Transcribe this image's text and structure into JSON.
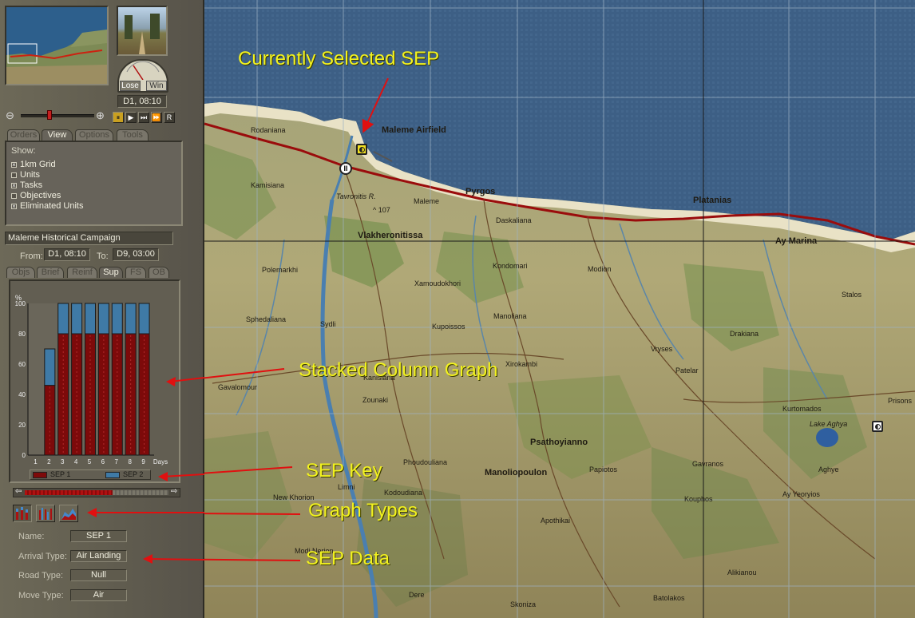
{
  "overview": {
    "time": "D1, 08:10",
    "lose_label": "Lose",
    "win_label": "Win"
  },
  "playback": {
    "buttons": [
      "⏸",
      "▶",
      "⏭",
      "⏩",
      "R"
    ]
  },
  "main_tabs": [
    "Orders",
    "View",
    "Options",
    "Tools"
  ],
  "view": {
    "show_label": "Show:",
    "options": [
      {
        "label": "1km Grid",
        "checked": true
      },
      {
        "label": "Units",
        "checked": false
      },
      {
        "label": "Tasks",
        "checked": true
      },
      {
        "label": "Objectives",
        "checked": false
      },
      {
        "label": "Eliminated Units",
        "checked": true
      }
    ]
  },
  "campaign": {
    "name": "Maleme Historical Campaign",
    "from_label": "From:",
    "from": "D1, 08:10",
    "to_label": "To:",
    "to": "D9, 03:00"
  },
  "sub_tabs": [
    "Objs",
    "Brief",
    "Reinf",
    "Sup",
    "FS",
    "OB"
  ],
  "chart_data": {
    "type": "bar",
    "stacked": true,
    "categories": [
      "1",
      "2",
      "3",
      "4",
      "5",
      "6",
      "7",
      "8",
      "9"
    ],
    "series": [
      {
        "name": "SEP 1",
        "values": [
          0,
          46,
          80,
          80,
          80,
          80,
          80,
          80,
          80
        ]
      },
      {
        "name": "SEP 2",
        "values": [
          0,
          24,
          20,
          20,
          20,
          20,
          20,
          20,
          20
        ]
      }
    ],
    "ylabel": "%",
    "xlabel": "Days",
    "yticks": [
      "0",
      "20",
      "40",
      "60",
      "80",
      "100"
    ],
    "ylim": [
      0,
      100
    ],
    "colors": {
      "sep1": "#7d0a0a",
      "sep2": "#3f7aa6"
    }
  },
  "sep_data": {
    "name_label": "Name:",
    "name": "SEP 1",
    "arrival_label": "Arrival Type:",
    "arrival": "Air Landing",
    "road_label": "Road Type:",
    "road": "Null",
    "move_label": "Move Type:",
    "move": "Air"
  },
  "annotations": {
    "selected": "Currently Selected SEP",
    "graph": "Stacked Column Graph",
    "key": "SEP Key",
    "types": "Graph Types",
    "data": "SEP Data"
  },
  "map": {
    "places": [
      {
        "name": "Rodaniana",
        "big": false
      },
      {
        "name": "Maleme Airfield",
        "big": true
      },
      {
        "name": "Kamisiana",
        "big": false
      },
      {
        "name": "Tavronitis R.",
        "big": false
      },
      {
        "name": "Maleme",
        "big": false
      },
      {
        "name": "Pyrgos",
        "big": true
      },
      {
        "name": "^ 107",
        "big": false
      },
      {
        "name": "Daskaliana",
        "big": false
      },
      {
        "name": "Vlakheronitissa",
        "big": true
      },
      {
        "name": "Platanias",
        "big": true
      },
      {
        "name": "Ay Marina",
        "big": true
      },
      {
        "name": "Polemarkhi",
        "big": false
      },
      {
        "name": "Kondomari",
        "big": false
      },
      {
        "name": "Modion",
        "big": false
      },
      {
        "name": "Xamoudokhori",
        "big": false
      },
      {
        "name": "Stalos",
        "big": false
      },
      {
        "name": "Sphedaliana",
        "big": false
      },
      {
        "name": "Sydli",
        "big": false
      },
      {
        "name": "Manoliana",
        "big": false
      },
      {
        "name": "Kupoissos",
        "big": false
      },
      {
        "name": "Drakiana",
        "big": false
      },
      {
        "name": "Vryses",
        "big": false
      },
      {
        "name": "Xirokambi",
        "big": false
      },
      {
        "name": "Patelar",
        "big": false
      },
      {
        "name": "Gavalomour",
        "big": false
      },
      {
        "name": "Kanisiana",
        "big": false
      },
      {
        "name": "Zounaki",
        "big": false
      },
      {
        "name": "Kurtomados",
        "big": false
      },
      {
        "name": "Prisons",
        "big": false
      },
      {
        "name": "Lake Aghya",
        "big": false
      },
      {
        "name": "Psathoyianno",
        "big": true
      },
      {
        "name": "Phoudouliana",
        "big": false
      },
      {
        "name": "Manoliopoulon",
        "big": true
      },
      {
        "name": "Papiotos",
        "big": false
      },
      {
        "name": "Gavranos",
        "big": false
      },
      {
        "name": "Aghye",
        "big": false
      },
      {
        "name": "Limni",
        "big": false
      },
      {
        "name": "Kodoudiana",
        "big": false
      },
      {
        "name": "New Khorion",
        "big": false
      },
      {
        "name": "Kouphos",
        "big": false
      },
      {
        "name": "Ay Yeoryios",
        "big": false
      },
      {
        "name": "Apothikai",
        "big": false
      },
      {
        "name": "Modi Nerion",
        "big": false
      },
      {
        "name": "Alikianou",
        "big": false
      },
      {
        "name": "Dere",
        "big": false
      },
      {
        "name": "Batolakos",
        "big": false
      },
      {
        "name": "Skoniza",
        "big": false
      }
    ]
  }
}
